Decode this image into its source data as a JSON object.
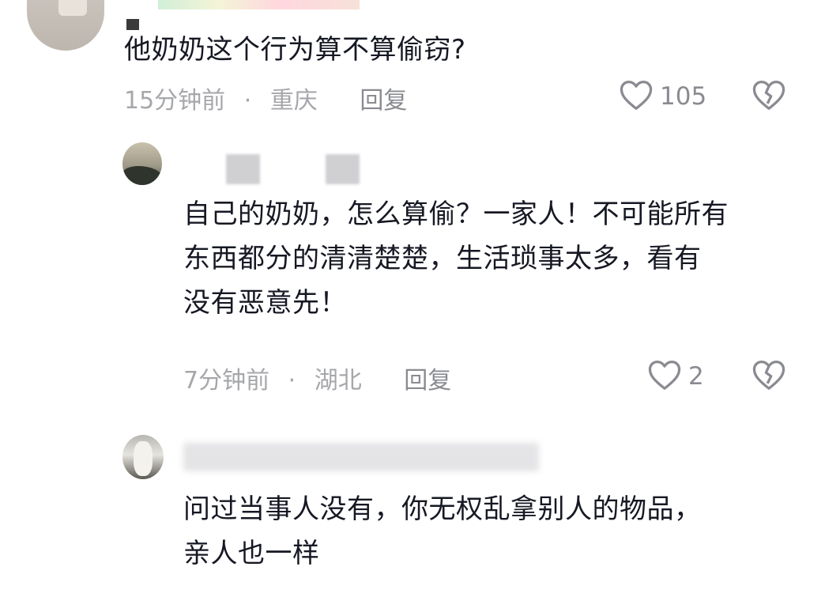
{
  "comments": [
    {
      "text": "他奶奶这个行为算不算偷窃?",
      "time": "15分钟前",
      "location": "重庆",
      "sep": "·",
      "reply_label": "回复",
      "likes": "105"
    },
    {
      "text_lines": [
        "自己的奶奶，怎么算偷？一家人！不可能所有",
        "东西都分的清清楚楚，生活琐事太多，看有",
        "没有恶意先！"
      ],
      "time": "7分钟前",
      "location": "湖北",
      "sep": "·",
      "reply_label": "回复",
      "likes": "2"
    },
    {
      "text_lines": [
        "问过当事人没有，你无权乱拿别人的物品，",
        "亲人也一样"
      ]
    }
  ],
  "colors": {
    "text": "#161823",
    "meta": "#a6a7ab",
    "icon": "#8a8b91"
  }
}
